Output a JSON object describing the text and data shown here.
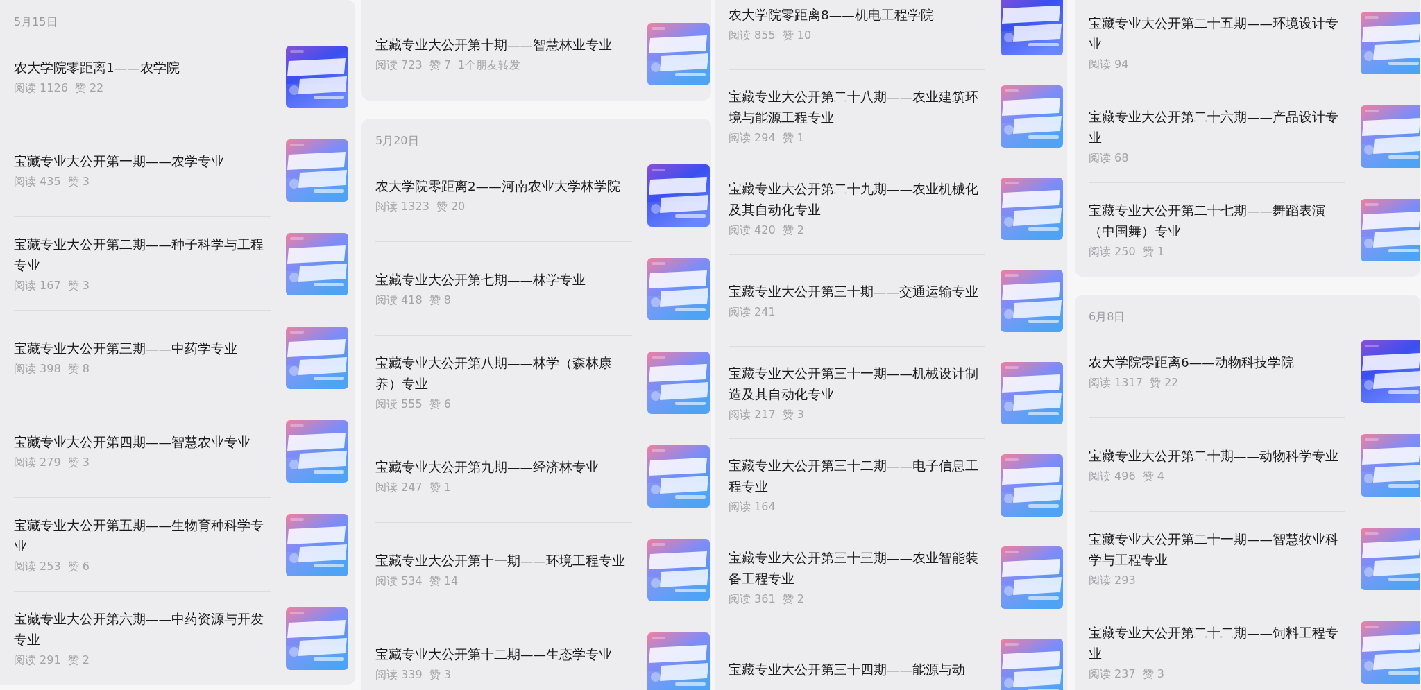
{
  "columns": [
    {
      "cards": [
        {
          "date": "5月15日",
          "articles": [
            {
              "kind": "college",
              "title": "农大学院零距离1——农学院",
              "reads": "阅读 1126",
              "likes": "赞 22"
            },
            {
              "kind": "major",
              "title": "宝藏专业大公开第一期——农学专业",
              "reads": "阅读 435",
              "likes": "赞 3"
            },
            {
              "kind": "major",
              "title": "宝藏专业大公开第二期——种子科学与工程专业",
              "reads": "阅读 167",
              "likes": "赞 3"
            },
            {
              "kind": "major",
              "title": "宝藏专业大公开第三期——中药学专业",
              "reads": "阅读 398",
              "likes": "赞 8"
            },
            {
              "kind": "major",
              "title": "宝藏专业大公开第四期——智慧农业专业",
              "reads": "阅读 279",
              "likes": "赞 3"
            },
            {
              "kind": "major",
              "title": "宝藏专业大公开第五期——生物育种科学专业",
              "reads": "阅读 253",
              "likes": "赞 6"
            },
            {
              "kind": "major",
              "title": "宝藏专业大公开第六期——中药资源与开发专业",
              "reads": "阅读 291",
              "likes": "赞 2"
            }
          ]
        }
      ]
    },
    {
      "cards": [
        {
          "articles": [
            {
              "kind": "major",
              "title": "宝藏专业大公开第十期——智慧林业专业",
              "reads": "阅读 723",
              "likes": "赞 7",
              "shares": "1个朋友转发"
            }
          ]
        },
        {
          "date": "5月20日",
          "articles": [
            {
              "kind": "college",
              "title": "农大学院零距离2——河南农业大学林学院",
              "reads": "阅读 1323",
              "likes": "赞 20"
            },
            {
              "kind": "major",
              "title": "宝藏专业大公开第七期——林学专业",
              "reads": "阅读 418",
              "likes": "赞 8"
            },
            {
              "kind": "major",
              "title": "宝藏专业大公开第八期——林学（森林康养）专业",
              "reads": "阅读 555",
              "likes": "赞 6"
            },
            {
              "kind": "major",
              "title": "宝藏专业大公开第九期——经济林专业",
              "reads": "阅读 247",
              "likes": "赞 1"
            },
            {
              "kind": "major",
              "title": "宝藏专业大公开第十一期——环境工程专业",
              "reads": "阅读 534",
              "likes": "赞 14"
            },
            {
              "kind": "major",
              "title": "宝藏专业大公开第十二期——生态学专业",
              "reads": "阅读 339",
              "likes": "赞 3"
            }
          ]
        }
      ]
    },
    {
      "cards": [
        {
          "articles": [
            {
              "kind": "college",
              "title": "农大学院零距离8——机电工程学院",
              "reads": "阅读 855",
              "likes": "赞 10"
            },
            {
              "kind": "major",
              "title": "宝藏专业大公开第二十八期——农业建筑环境与能源工程专业",
              "reads": "阅读 294",
              "likes": "赞 1"
            },
            {
              "kind": "major",
              "title": "宝藏专业大公开第二十九期——农业机械化及其自动化专业",
              "reads": "阅读 420",
              "likes": "赞 2"
            },
            {
              "kind": "major",
              "title": "宝藏专业大公开第三十期——交通运输专业",
              "reads": "阅读 241"
            },
            {
              "kind": "major",
              "title": "宝藏专业大公开第三十一期——机械设计制造及其自动化专业",
              "reads": "阅读 217",
              "likes": "赞 3"
            },
            {
              "kind": "major",
              "title": "宝藏专业大公开第三十二期——电子信息工程专业",
              "reads": "阅读 164"
            },
            {
              "kind": "major",
              "title": "宝藏专业大公开第三十三期——农业智能装备工程专业",
              "reads": "阅读 361",
              "likes": "赞 2"
            },
            {
              "kind": "major",
              "title": "宝藏专业大公开第三十四期——能源与动"
            }
          ]
        }
      ]
    },
    {
      "cards": [
        {
          "articles": [
            {
              "kind": "major",
              "title": "宝藏专业大公开第二十五期——环境设计专业",
              "reads": "阅读 94"
            },
            {
              "kind": "major",
              "title": "宝藏专业大公开第二十六期——产品设计专业",
              "reads": "阅读 68"
            },
            {
              "kind": "major",
              "title": "宝藏专业大公开第二十七期——舞蹈表演（中国舞）专业",
              "reads": "阅读 250",
              "likes": "赞 1"
            }
          ]
        },
        {
          "date": "6月8日",
          "articles": [
            {
              "kind": "college",
              "title": "农大学院零距离6——动物科技学院",
              "reads": "阅读 1317",
              "likes": "赞 22"
            },
            {
              "kind": "major",
              "title": "宝藏专业大公开第二十期——动物科学专业",
              "reads": "阅读 496",
              "likes": "赞 4"
            },
            {
              "kind": "major",
              "title": "宝藏专业大公开第二十一期——智慧牧业科学与工程专业",
              "reads": "阅读 293"
            },
            {
              "kind": "major",
              "title": "宝藏专业大公开第二十二期——饲料工程专业",
              "reads": "阅读 237",
              "likes": "赞 3"
            }
          ]
        }
      ]
    }
  ]
}
